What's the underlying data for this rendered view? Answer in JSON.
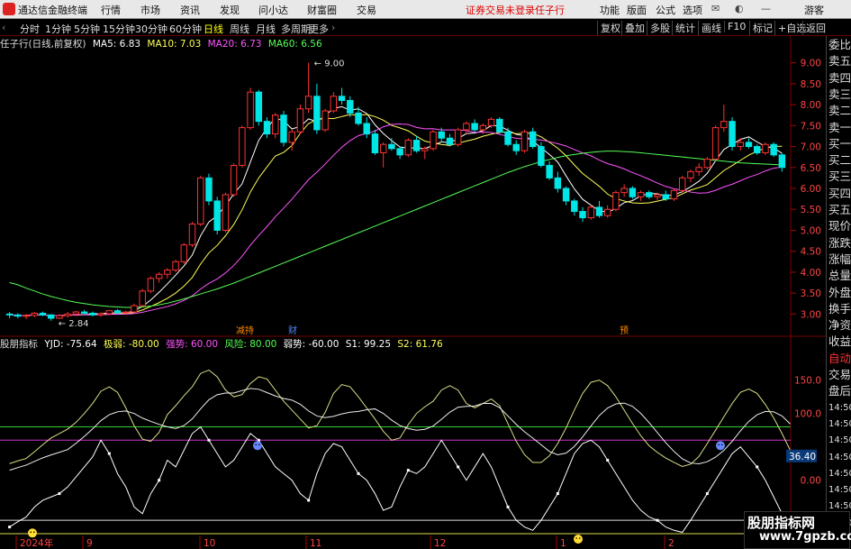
{
  "app": {
    "title": "通达信金融终端",
    "login_warning": "证券交易未登录",
    "stock_name": "任子行",
    "guest": "游客"
  },
  "menu": [
    "行情",
    "市场",
    "资讯",
    "发现",
    "问小达",
    "财富圈",
    "交易"
  ],
  "right_menu": [
    "功能",
    "版面",
    "公式",
    "选项"
  ],
  "timeframes": [
    "分时",
    "1分钟",
    "5分钟",
    "15分钟",
    "30分钟",
    "60分钟",
    "日线",
    "周线",
    "月线",
    "多周期",
    "更多"
  ],
  "active_timeframe": "日线",
  "toolbar_buttons": [
    "复权",
    "叠加",
    "多股",
    "统计",
    "画线",
    "F10",
    "标记",
    "+自选",
    "返回"
  ],
  "main_info": {
    "name": "任子行(日线,前复权)",
    "ma5": "MA5: 6.83",
    "ma10": "MA10: 7.03",
    "ma20": "MA20: 6.73",
    "ma60": "MA60: 6.56"
  },
  "indicator_info": {
    "name": "股朋指标",
    "yjd": "YJD: -75.64",
    "jr": "极弱: -80.00",
    "qs": "强势: 60.00",
    "fx": "风险: 80.00",
    "rs": "弱势: -60.00",
    "s1": "S1: 99.25",
    "s2": "S2: 61.76"
  },
  "price_axis": [
    "9.00",
    "8.50",
    "8.00",
    "7.50",
    "7.00",
    "6.50",
    "6.00",
    "5.50",
    "5.00",
    "4.50",
    "4.00",
    "3.50",
    "3.00"
  ],
  "indicator_axis": [
    "150.0",
    "100.0",
    "36.40",
    "0.00"
  ],
  "date_labels": [
    "2024年",
    "9",
    "10",
    "11",
    "12",
    "1",
    "2"
  ],
  "annotations": {
    "max": "9.00",
    "min": "2.84",
    "mark1": "减持",
    "mark2": "财",
    "mark3": "预"
  },
  "right_panel": [
    "委比",
    "卖五",
    "卖四",
    "卖三",
    "卖二",
    "卖一",
    "买一",
    "买二",
    "买三",
    "买四",
    "买五",
    "现价",
    "涨跌",
    "涨幅",
    "总量",
    "外盘",
    "换手",
    "净资",
    "收益",
    "自动",
    "交易",
    "盘后",
    "14:50",
    "14:50",
    "14:50",
    "14:50",
    "14:50",
    "14:50",
    "14:50",
    "14:50"
  ],
  "watermark": {
    "line1": "股朋指标网",
    "line2": "www.7gpzb.com"
  },
  "colors": {
    "up": "#ff3333",
    "down": "#00e5e5",
    "ma5": "#ffffff",
    "ma10": "#ffff55",
    "ma20": "#ff55ff",
    "ma60": "#55ff55"
  },
  "chart_data": {
    "type": "candlestick",
    "price_range": [
      2.75,
      9.25
    ],
    "indicator_range": [
      -80,
      190
    ],
    "candles": [
      [
        3.0,
        3.05,
        2.9,
        2.98
      ],
      [
        2.98,
        3.02,
        2.9,
        2.95
      ],
      [
        2.95,
        3.0,
        2.88,
        2.97
      ],
      [
        2.97,
        3.05,
        2.92,
        3.02
      ],
      [
        3.02,
        3.06,
        2.95,
        2.98
      ],
      [
        2.98,
        3.0,
        2.84,
        2.9
      ],
      [
        2.9,
        3.0,
        2.88,
        2.96
      ],
      [
        2.96,
        3.05,
        2.92,
        3.0
      ],
      [
        3.0,
        3.08,
        2.95,
        3.05
      ],
      [
        3.05,
        3.1,
        3.0,
        3.02
      ],
      [
        3.02,
        3.06,
        2.95,
        2.98
      ],
      [
        2.98,
        3.04,
        2.93,
        3.01
      ],
      [
        3.01,
        3.1,
        2.98,
        3.08
      ],
      [
        3.08,
        3.12,
        3.0,
        3.03
      ],
      [
        3.03,
        3.08,
        2.98,
        3.05
      ],
      [
        3.05,
        3.25,
        3.03,
        3.2
      ],
      [
        3.2,
        3.6,
        3.18,
        3.55
      ],
      [
        3.55,
        3.9,
        3.5,
        3.85
      ],
      [
        3.85,
        4.0,
        3.75,
        3.95
      ],
      [
        3.95,
        4.1,
        3.85,
        4.05
      ],
      [
        4.05,
        4.3,
        4.0,
        4.25
      ],
      [
        4.25,
        4.7,
        4.2,
        4.65
      ],
      [
        4.65,
        5.2,
        4.6,
        5.15
      ],
      [
        5.15,
        6.3,
        5.1,
        6.25
      ],
      [
        6.25,
        6.35,
        5.6,
        5.7
      ],
      [
        5.7,
        5.8,
        4.9,
        5.0
      ],
      [
        5.0,
        5.9,
        4.95,
        5.85
      ],
      [
        5.85,
        6.6,
        5.8,
        6.55
      ],
      [
        6.55,
        7.5,
        6.5,
        7.45
      ],
      [
        7.45,
        8.4,
        7.4,
        8.3
      ],
      [
        8.3,
        8.35,
        7.5,
        7.6
      ],
      [
        7.6,
        7.7,
        7.2,
        7.3
      ],
      [
        7.3,
        7.8,
        7.2,
        7.75
      ],
      [
        7.75,
        7.85,
        7.0,
        7.1
      ],
      [
        7.1,
        7.4,
        6.9,
        7.35
      ],
      [
        7.35,
        8.0,
        7.3,
        7.9
      ],
      [
        7.9,
        9.0,
        7.8,
        8.2
      ],
      [
        8.2,
        8.5,
        7.3,
        7.4
      ],
      [
        7.4,
        7.9,
        7.35,
        7.85
      ],
      [
        7.85,
        8.3,
        7.8,
        8.2
      ],
      [
        8.2,
        8.4,
        8.0,
        8.1
      ],
      [
        8.1,
        8.2,
        7.7,
        7.8
      ],
      [
        7.8,
        7.95,
        7.5,
        7.55
      ],
      [
        7.55,
        7.7,
        7.2,
        7.3
      ],
      [
        7.3,
        7.4,
        6.8,
        6.85
      ],
      [
        6.85,
        7.1,
        6.5,
        7.05
      ],
      [
        7.05,
        7.2,
        6.9,
        6.95
      ],
      [
        6.95,
        7.0,
        6.7,
        6.8
      ],
      [
        6.8,
        7.2,
        6.75,
        7.15
      ],
      [
        7.15,
        7.25,
        6.85,
        6.9
      ],
      [
        6.9,
        7.0,
        6.7,
        6.95
      ],
      [
        6.95,
        7.4,
        6.9,
        7.35
      ],
      [
        7.35,
        7.45,
        7.1,
        7.2
      ],
      [
        7.2,
        7.3,
        7.0,
        7.05
      ],
      [
        7.05,
        7.45,
        7.0,
        7.4
      ],
      [
        7.4,
        7.6,
        7.3,
        7.55
      ],
      [
        7.55,
        7.65,
        7.35,
        7.4
      ],
      [
        7.4,
        7.55,
        7.3,
        7.5
      ],
      [
        7.5,
        7.7,
        7.45,
        7.65
      ],
      [
        7.65,
        7.7,
        7.3,
        7.35
      ],
      [
        7.35,
        7.45,
        7.0,
        7.05
      ],
      [
        7.05,
        7.15,
        6.8,
        6.9
      ],
      [
        6.9,
        7.4,
        6.85,
        7.35
      ],
      [
        7.35,
        7.45,
        6.95,
        7.0
      ],
      [
        7.0,
        7.1,
        6.5,
        6.55
      ],
      [
        6.55,
        6.65,
        6.2,
        6.25
      ],
      [
        6.25,
        6.4,
        5.9,
        6.0
      ],
      [
        6.0,
        6.05,
        5.6,
        5.7
      ],
      [
        5.7,
        5.75,
        5.35,
        5.45
      ],
      [
        5.45,
        5.55,
        5.2,
        5.3
      ],
      [
        5.3,
        5.6,
        5.25,
        5.55
      ],
      [
        5.55,
        5.7,
        5.3,
        5.35
      ],
      [
        5.35,
        5.6,
        5.3,
        5.5
      ],
      [
        5.5,
        5.95,
        5.45,
        5.9
      ],
      [
        5.9,
        6.1,
        5.8,
        6.0
      ],
      [
        6.0,
        6.05,
        5.75,
        5.8
      ],
      [
        5.8,
        5.95,
        5.7,
        5.9
      ],
      [
        5.9,
        5.95,
        5.75,
        5.8
      ],
      [
        5.8,
        5.9,
        5.72,
        5.85
      ],
      [
        5.85,
        5.95,
        5.7,
        5.75
      ],
      [
        5.75,
        6.0,
        5.7,
        5.95
      ],
      [
        5.95,
        6.3,
        5.9,
        6.25
      ],
      [
        6.25,
        6.45,
        6.15,
        6.4
      ],
      [
        6.4,
        6.6,
        6.3,
        6.5
      ],
      [
        6.5,
        6.75,
        6.45,
        6.7
      ],
      [
        6.7,
        7.5,
        6.65,
        7.45
      ],
      [
        7.45,
        8.0,
        7.35,
        7.6
      ],
      [
        7.6,
        7.7,
        6.9,
        7.0
      ],
      [
        7.0,
        7.2,
        6.9,
        7.1
      ],
      [
        7.1,
        7.2,
        6.95,
        7.0
      ],
      [
        7.0,
        7.05,
        6.8,
        6.85
      ],
      [
        6.85,
        7.1,
        6.8,
        7.05
      ],
      [
        7.05,
        7.1,
        6.75,
        6.8
      ],
      [
        6.8,
        6.85,
        6.4,
        6.5
      ]
    ],
    "ma60": [
      3.75,
      3.7,
      3.62,
      3.55,
      3.48,
      3.42,
      3.37,
      3.32,
      3.28,
      3.25,
      3.22,
      3.2,
      3.18,
      3.17,
      3.16,
      3.16,
      3.17,
      3.19,
      3.22,
      3.26,
      3.31,
      3.36,
      3.42,
      3.48,
      3.54,
      3.6,
      3.67,
      3.74,
      3.82,
      3.9,
      3.98,
      4.06,
      4.14,
      4.22,
      4.3,
      4.38,
      4.46,
      4.54,
      4.62,
      4.7,
      4.78,
      4.86,
      4.94,
      5.02,
      5.1,
      5.18,
      5.26,
      5.34,
      5.42,
      5.5,
      5.58,
      5.66,
      5.74,
      5.82,
      5.9,
      5.98,
      6.06,
      6.14,
      6.22,
      6.3,
      6.38,
      6.45,
      6.52,
      6.58,
      6.64,
      6.69,
      6.74,
      6.78,
      6.81,
      6.84,
      6.86,
      6.88,
      6.89,
      6.89,
      6.88,
      6.87,
      6.85,
      6.83,
      6.81,
      6.79,
      6.77,
      6.75,
      6.73,
      6.71,
      6.69,
      6.67,
      6.65,
      6.63,
      6.61,
      6.6,
      6.59,
      6.58,
      6.57,
      6.56
    ],
    "yjd": [
      -70,
      -62,
      -55,
      -40,
      -30,
      -25,
      -20,
      -10,
      5,
      20,
      35,
      60,
      40,
      10,
      -10,
      -40,
      -50,
      -20,
      0,
      30,
      20,
      45,
      70,
      80,
      60,
      40,
      20,
      30,
      50,
      70,
      60,
      40,
      20,
      10,
      0,
      -20,
      -30,
      10,
      40,
      55,
      50,
      30,
      10,
      0,
      -20,
      -45,
      -40,
      -10,
      15,
      10,
      20,
      40,
      60,
      40,
      20,
      0,
      20,
      40,
      20,
      -10,
      -40,
      -60,
      -70,
      -75,
      -60,
      -40,
      -20,
      10,
      40,
      55,
      60,
      50,
      30,
      10,
      -10,
      -30,
      -45,
      -55,
      -60,
      -70,
      -75,
      -78,
      -60,
      -40,
      -20,
      0,
      20,
      40,
      50,
      35,
      20,
      0,
      -25,
      -50,
      -76
    ]
  }
}
